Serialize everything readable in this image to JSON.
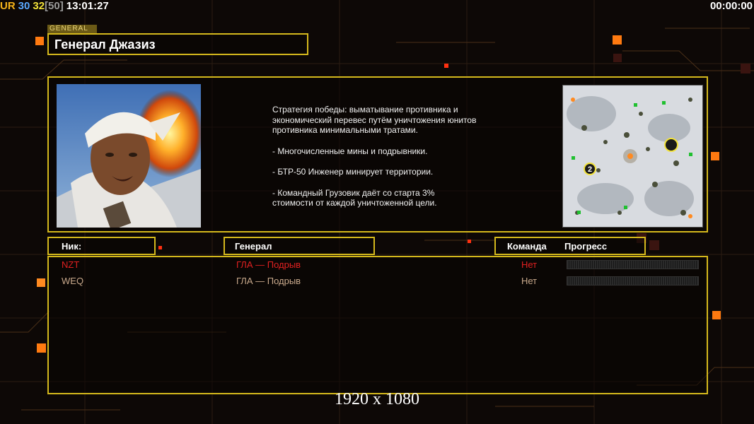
{
  "hud": {
    "ur": "UR",
    "n1": "30",
    "n2": "32",
    "n3": "[50]",
    "time": "13:01:27",
    "timer": "00:00:00"
  },
  "general_tag": "GENERAL",
  "title": "Генерал Джазиз",
  "description": [
    "Стратегия победы: выматывание противника и\n экономический перевес путём уничтожения юнитов\n противника минимальными тратами.",
    "- Многочисленные мины и подрывники.",
    "- БТР-50 Инженер минирует территории.",
    "- Командный Грузовик даёт со старта 3%\n стоимости от каждой уничтоженной цели."
  ],
  "headers": {
    "nick": "Ник:",
    "general": "Генерал",
    "team": "Команда",
    "progress": "Прогресс"
  },
  "players": [
    {
      "nick": "NZT",
      "general": "ГЛА — Подрыв",
      "team": "Нет",
      "color": "#e02020"
    },
    {
      "nick": "WEQ",
      "general": "ГЛА — Подрыв",
      "team": "Нет",
      "color": "#c9a98c"
    }
  ],
  "minimap_marker": "2",
  "resolution": "1920 x 1080",
  "colors": {
    "accent_border": "#d4b81c",
    "hud_ur": "#f4b21a",
    "hud_n1": "#5aa9ff",
    "hud_n2": "#f2e23a",
    "hud_n3": "#9a9a9a"
  }
}
